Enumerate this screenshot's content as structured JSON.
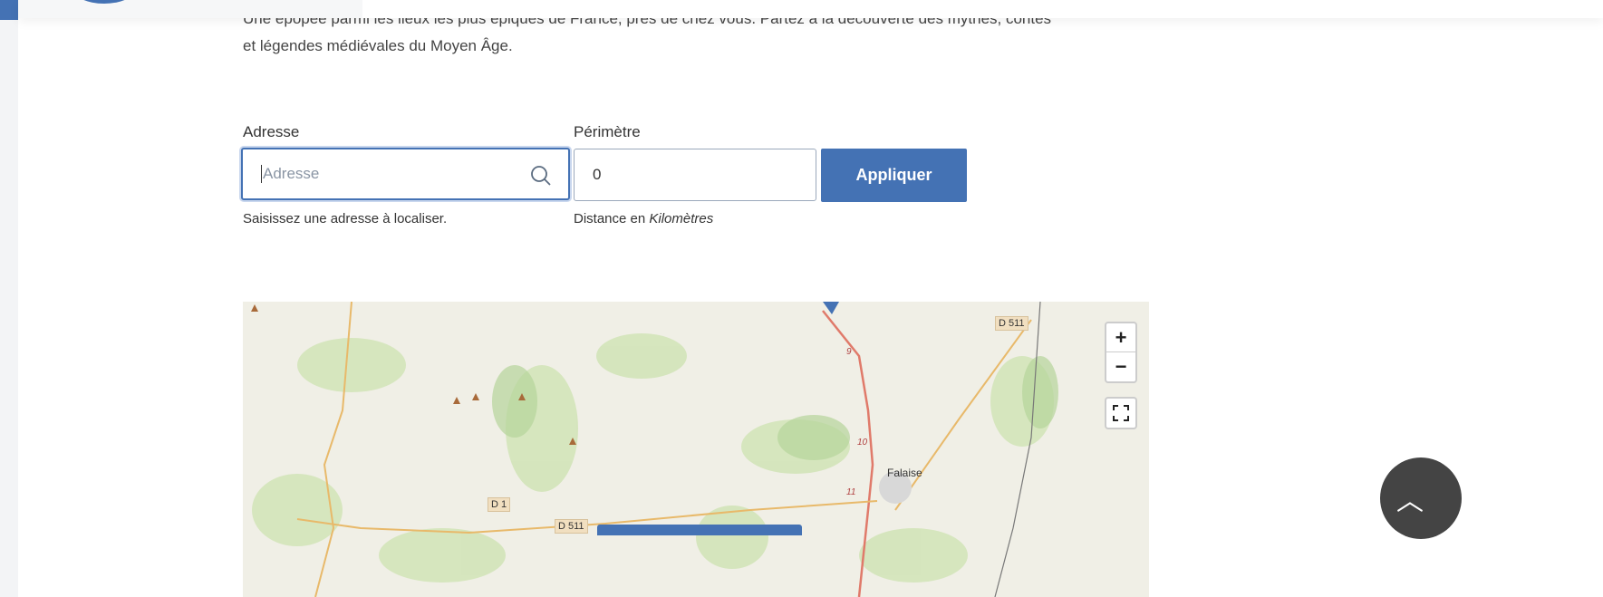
{
  "intro": {
    "line1": "Une épopée parmi les lieux les plus épiques de France, près de chez vous. Partez à la découverte des mythes, contes",
    "line2": "et légendes médiévales du Moyen Âge."
  },
  "form": {
    "address_label": "Adresse",
    "address_placeholder": "Adresse",
    "address_value": "",
    "address_help": "Saisissez une adresse à localiser.",
    "perimeter_label": "Périmètre",
    "perimeter_value": "0",
    "perimeter_help_prefix": "Distance en ",
    "perimeter_help_unit": "Kilomètres",
    "apply_label": "Appliquer"
  },
  "map": {
    "labels": {
      "falaise": "Falaise",
      "d511a": "D 511",
      "d511b": "D 511",
      "d1": "D 1",
      "km9": "9",
      "km10": "10",
      "km11": "11"
    },
    "zoom_in": "+",
    "zoom_out": "−"
  },
  "colors": {
    "accent": "#4472b4"
  }
}
